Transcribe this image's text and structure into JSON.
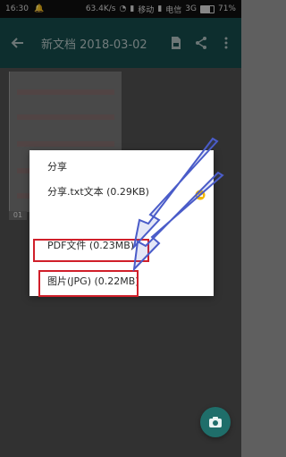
{
  "status_bar": {
    "time": "16:30",
    "network_speed": "63.4K/s",
    "carrier1": "移动",
    "carrier2": "电信",
    "network_type": "3G",
    "battery": "71%"
  },
  "app_bar": {
    "title": "新文档 2018-03-02"
  },
  "document": {
    "page_number": "01"
  },
  "share_dialog": {
    "title": "分享",
    "items": [
      {
        "label": "分享.txt文本 (0.29KB)"
      },
      {
        "label": "PDF文件 (0.23MB)"
      },
      {
        "label": "图片(JPG) (0.22MB)"
      }
    ]
  },
  "colors": {
    "appbar": "#164b4b",
    "highlight": "#d01f2a",
    "arrow": "#4a5cc9",
    "fab": "#1f6e6a"
  }
}
